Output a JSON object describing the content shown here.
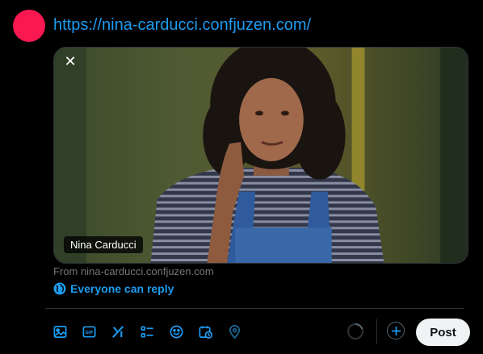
{
  "composer": {
    "text": "https://nina-carducci.confjuzen.com/",
    "avatar_color": "#f91850"
  },
  "card": {
    "title": "Nina Carducci",
    "source": "From nina-carducci.confjuzen.com",
    "close_icon": "close-icon",
    "image_description": "portrait photo"
  },
  "reply": {
    "label": "Everyone can reply",
    "icon": "globe-icon"
  },
  "toolbar": {
    "icons": [
      "media-icon",
      "gif-icon",
      "grok-icon",
      "poll-icon",
      "emoji-icon",
      "schedule-icon",
      "location-icon"
    ],
    "post_label": "Post"
  },
  "colors": {
    "accent": "#1d9bf0",
    "background": "#000000",
    "post_button": "#eff3f4"
  }
}
